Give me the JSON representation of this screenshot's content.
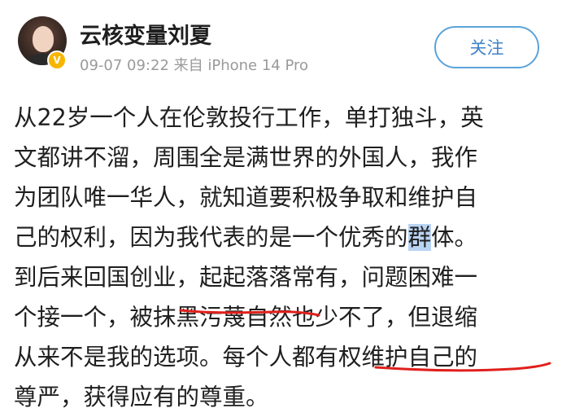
{
  "user": {
    "name": "云核变量刘夏",
    "verified_icon": "v-badge-icon",
    "verified_text": "V",
    "meta": "09-07 09:22 来自 iPhone 14 Pro"
  },
  "actions": {
    "follow_label": "关注"
  },
  "post": {
    "lines": [
      {
        "text": "从22岁一个人在伦敦投行工作，单打独斗，英"
      },
      {
        "text": "文都讲不溜，周围全是满世界的外国人，我作"
      },
      {
        "text": "为团队唯一华人，就知道要积极争取和维护自"
      },
      {
        "pre": "己的权利，因为我代表的是一个优秀的",
        "highlight": "群",
        "post": "体。"
      },
      {
        "text": "到后来回国创业，起起落落常有，问题困难一"
      },
      {
        "text": "个接一个，被抹黑污蔑自然也少不了，但退缩"
      },
      {
        "text": "从来不是我的选项。每个人都有权维护自己的"
      },
      {
        "text": "尊严，获得应有的尊重。"
      }
    ]
  },
  "colors": {
    "accent": "#3f84c8",
    "highlight": "#b9d3f3",
    "annotation": "#e0201c",
    "badge": "#f7b500"
  }
}
